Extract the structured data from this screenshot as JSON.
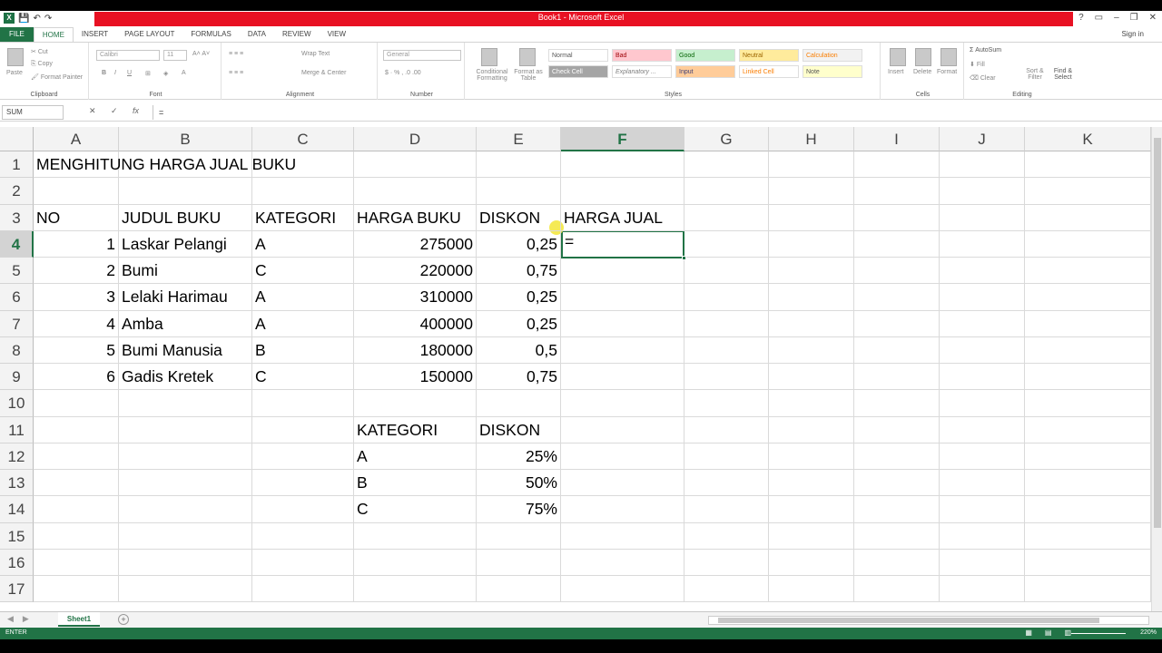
{
  "window": {
    "title": "Book1 - Microsoft Excel",
    "sign_in": "Sign in"
  },
  "qat": {
    "app_icon": "X",
    "save": "💾",
    "undo": "↶",
    "redo": "↷"
  },
  "ribbon_tabs": [
    "FILE",
    "HOME",
    "INSERT",
    "PAGE LAYOUT",
    "FORMULAS",
    "DATA",
    "REVIEW",
    "VIEW"
  ],
  "ribbon": {
    "clipboard": {
      "paste": "Paste",
      "cut": "Cut",
      "copy": "Copy",
      "format_painter": "Format Painter",
      "label": "Clipboard"
    },
    "font": {
      "name": "Calibri",
      "size": "11",
      "label": "Font"
    },
    "alignment": {
      "wrap": "Wrap Text",
      "merge": "Merge & Center",
      "label": "Alignment"
    },
    "number": {
      "format": "General",
      "label": "Number"
    },
    "styles": {
      "conditional": "Conditional Formatting",
      "format_table": "Format as Table",
      "cells": [
        "Normal",
        "Bad",
        "Good",
        "Neutral",
        "Calculation",
        "Check Cell",
        "Explanatory ...",
        "Input",
        "Linked Cell",
        "Note"
      ],
      "label": "Styles"
    },
    "cells": {
      "insert": "Insert",
      "delete": "Delete",
      "format": "Format",
      "label": "Cells"
    },
    "editing": {
      "autosum": "AutoSum",
      "fill": "Fill",
      "clear": "Clear",
      "sort": "Sort & Filter",
      "find": "Find & Select",
      "label": "Editing"
    }
  },
  "formula_bar": {
    "name_box": "SUM",
    "cancel": "✕",
    "enter": "✓",
    "fx": "fx",
    "content": "="
  },
  "columns": [
    "A",
    "B",
    "C",
    "D",
    "E",
    "F",
    "G",
    "H",
    "I",
    "J",
    "K"
  ],
  "selected_column": "F",
  "rows": [
    "1",
    "2",
    "3",
    "4",
    "5",
    "6",
    "7",
    "8",
    "9",
    "10",
    "11",
    "12",
    "13",
    "14",
    "15",
    "16",
    "17"
  ],
  "selected_row": "4",
  "sheet": {
    "title": "MENGHITUNG HARGA JUAL BUKU",
    "headers": [
      "NO",
      "JUDUL BUKU",
      "KATEGORI",
      "HARGA BUKU",
      "DISKON",
      "HARGA JUAL"
    ],
    "data": [
      [
        "1",
        "Laskar Pelangi",
        "A",
        "275000",
        "0,25"
      ],
      [
        "2",
        "Bumi",
        "C",
        "220000",
        "0,75"
      ],
      [
        "3",
        "Lelaki Harimau",
        "A",
        "310000",
        "0,25"
      ],
      [
        "4",
        "Amba",
        "A",
        "400000",
        "0,25"
      ],
      [
        "5",
        "Bumi Manusia",
        "B",
        "180000",
        "0,5"
      ],
      [
        "6",
        "Gadis Kretek",
        "C",
        "150000",
        "0,75"
      ]
    ],
    "active_cell_value": "=",
    "lookup_headers": [
      "KATEGORI",
      "DISKON"
    ],
    "lookup": [
      [
        "A",
        "25%"
      ],
      [
        "B",
        "50%"
      ],
      [
        "C",
        "75%"
      ]
    ]
  },
  "sheet_tabs": [
    "Sheet1"
  ],
  "status": {
    "mode": "ENTER",
    "zoom": "220%"
  }
}
